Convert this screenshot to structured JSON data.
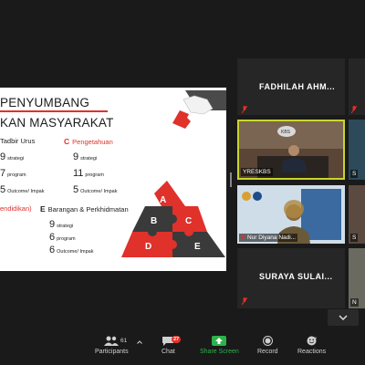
{
  "slide": {
    "title_line1": "PENYUMBANG",
    "title_line2": "KAN MASYARAKAT",
    "pieces": [
      "A",
      "B",
      "C",
      "D",
      "E"
    ],
    "sections": {
      "tadbir": {
        "header": "Tadbir Urus",
        "rows": [
          {
            "num": "9",
            "label": "strategi"
          },
          {
            "num": "7",
            "label": "program"
          },
          {
            "num": "5",
            "label": "Outcome/ Impak"
          }
        ]
      },
      "pengetahuan": {
        "letter": "C",
        "header": "Pengetahuan",
        "rows": [
          {
            "num": "9",
            "label": "strategi"
          },
          {
            "num": "11",
            "label": "program"
          },
          {
            "num": "5",
            "label": "Outcome/ Impak"
          }
        ]
      },
      "pendidikan": {
        "header": "endidikan)"
      },
      "barangan": {
        "letter": "E",
        "header": "Barangan & Perkhidmatan",
        "rows": [
          {
            "num": "9",
            "label": "strategi"
          },
          {
            "num": "6",
            "label": "program"
          },
          {
            "num": "6",
            "label": "Outcome/ Impak"
          }
        ]
      }
    }
  },
  "gallery": {
    "tile1_name": "FADHILAH AHM...",
    "tile2_label": "YRESKBS",
    "tile2_badge": "KBS",
    "tile3_label": "Nur Diyana Nadi...",
    "tile4_name": "SURAYA SULAI...",
    "side_initials": [
      "S",
      "S",
      "N"
    ]
  },
  "toolbar": {
    "participants_label": "Participants",
    "participants_count": "61",
    "chat_label": "Chat",
    "chat_badge": "27",
    "share_label": "Share Screen",
    "record_label": "Record",
    "reactions_label": "Reactions"
  },
  "colors": {
    "accent_red": "#e0312b",
    "active_speaker": "#c8d62a",
    "share_green": "#2db34a"
  }
}
